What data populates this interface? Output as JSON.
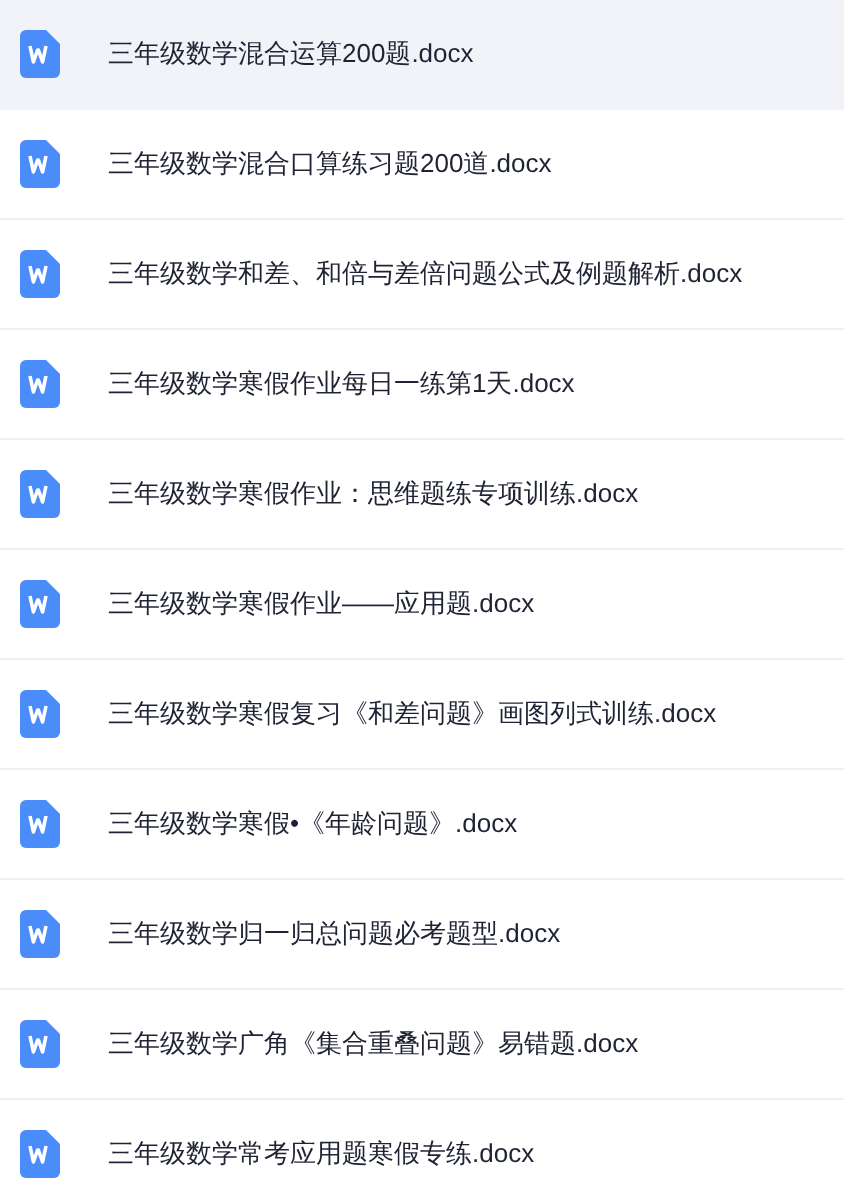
{
  "files": [
    {
      "name": "三年级数学混合运算200题.docx",
      "selected": true
    },
    {
      "name": "三年级数学混合口算练习题200道.docx",
      "selected": false
    },
    {
      "name": "三年级数学和差、和倍与差倍问题公式及例题解析.docx",
      "selected": false
    },
    {
      "name": "三年级数学寒假作业每日一练第1天.docx",
      "selected": false
    },
    {
      "name": "三年级数学寒假作业：思维题练专项训练.docx",
      "selected": false
    },
    {
      "name": "三年级数学寒假作业——应用题.docx",
      "selected": false
    },
    {
      "name": "三年级数学寒假复习《和差问题》画图列式训练.docx",
      "selected": false
    },
    {
      "name": "三年级数学寒假•《年龄问题》.docx",
      "selected": false
    },
    {
      "name": "三年级数学归一归总问题必考题型.docx",
      "selected": false
    },
    {
      "name": "三年级数学广角《集合重叠问题》易错题.docx",
      "selected": false
    },
    {
      "name": "三年级数学常考应用题寒假专练.docx",
      "selected": false
    }
  ]
}
